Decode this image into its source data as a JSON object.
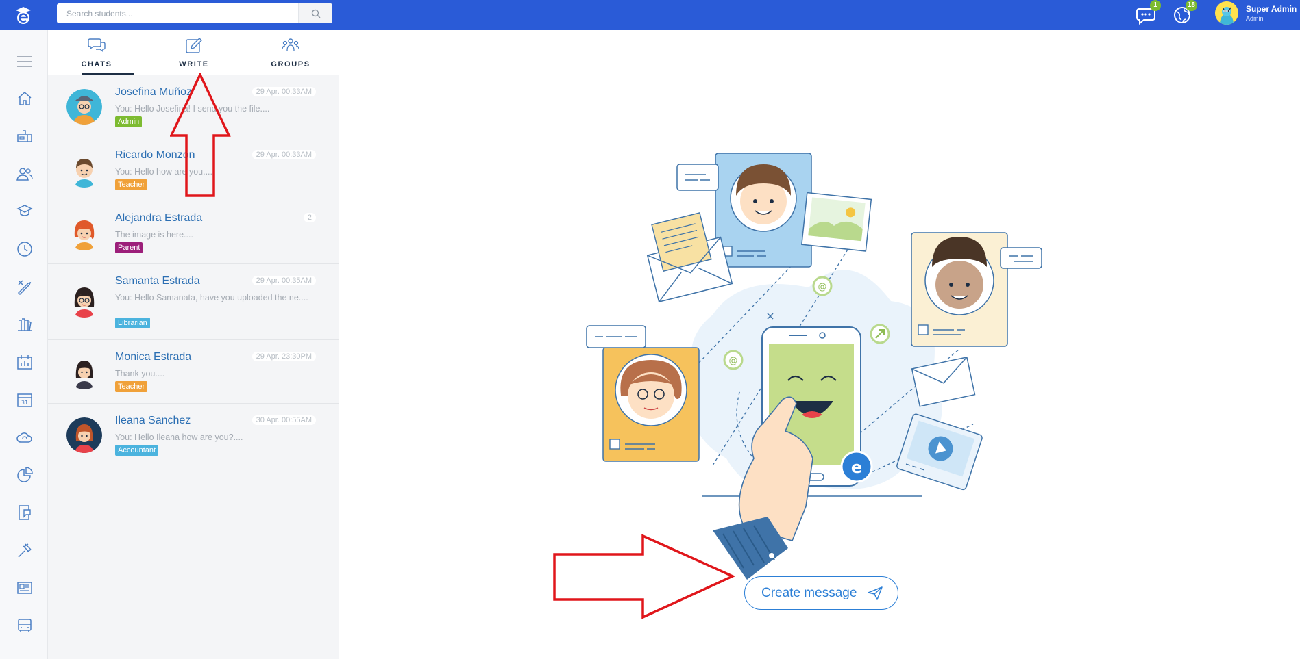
{
  "header": {
    "search_placeholder": "Search students...",
    "chat_badge": "1",
    "globe_badge": "18",
    "user_name": "Super Admin",
    "user_role": "Admin"
  },
  "sidenav": {
    "icons": [
      "menu-icon",
      "home-icon",
      "mailbox-icon",
      "users-icon",
      "graduation-icon",
      "clock-icon",
      "tools-icon",
      "library-icon",
      "calendar-chart-icon",
      "calendar-icon",
      "cloud-icon",
      "pie-chart-icon",
      "report-icon",
      "gavel-icon",
      "newspaper-icon",
      "bus-icon"
    ]
  },
  "tabs": [
    {
      "label": "CHATS",
      "icon": "chats-icon"
    },
    {
      "label": "WRITE",
      "icon": "write-icon"
    },
    {
      "label": "GROUPS",
      "icon": "groups-icon"
    }
  ],
  "chats": [
    {
      "name": "Josefina Muñoz",
      "time": "29 Apr. 00:33AM",
      "message": "You: Hello Josefina! I send you the file....",
      "role": "Admin",
      "role_color": "#7dbb31",
      "avatar_bg": "#3fb6d8"
    },
    {
      "name": "Ricardo Monzon",
      "time": "29 Apr. 00:33AM",
      "message": "You: Hello how are you....",
      "role": "Teacher",
      "role_color": "#f0a13a",
      "avatar_bg": "#f4f5f7"
    },
    {
      "name": "Alejandra Estrada",
      "time": "2",
      "message": "The image is here....",
      "role": "Parent",
      "role_color": "#9c1f7a",
      "avatar_bg": "#f4f5f7"
    },
    {
      "name": "Samanta Estrada",
      "time": "29 Apr. 00:35AM",
      "message": "You: Hello Samanata, have you uploaded the ne....",
      "role": "Librarian",
      "role_color": "#4bb3de",
      "avatar_bg": "#f4f5f7"
    },
    {
      "name": "Monica Estrada",
      "time": "29 Apr. 23:30PM",
      "message": "Thank you....",
      "role": "Teacher",
      "role_color": "#f0a13a",
      "avatar_bg": "#f4f5f7"
    },
    {
      "name": "Ileana Sanchez",
      "time": "30 Apr. 00:55AM",
      "message": "You: Hello Ileana how are you?....",
      "role": "Accountant",
      "role_color": "#4bb3de",
      "avatar_bg": "#1d3b5a"
    }
  ],
  "main": {
    "create_label": "Create message"
  },
  "colors": {
    "topbar": "#2a5bd7",
    "accent": "#2c7fd6",
    "annotation_arrow": "#e0161b"
  }
}
